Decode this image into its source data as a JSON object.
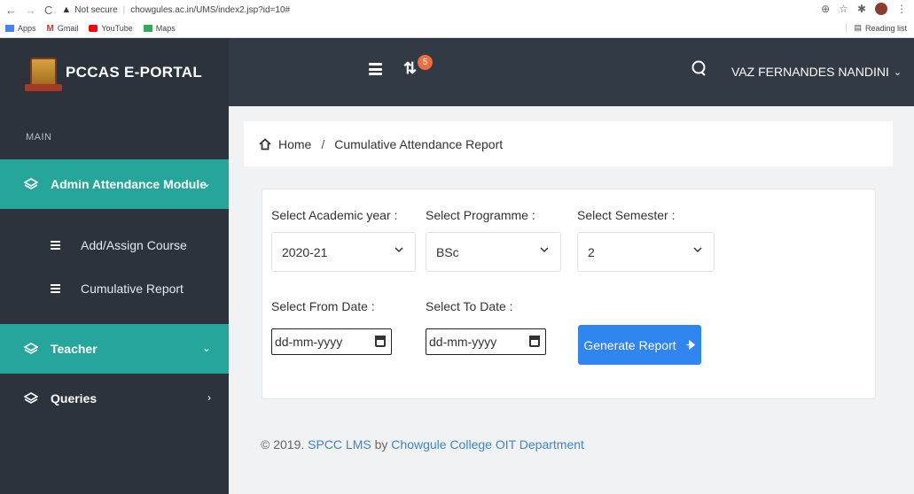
{
  "browser": {
    "not_secure": "Not secure",
    "url": "chowgules.ac.in/UMS/index2.jsp?id=10#",
    "bookmarks": [
      {
        "label": "Apps",
        "color": "#4285f4"
      },
      {
        "label": "Gmail",
        "color": "#d93025"
      },
      {
        "label": "YouTube",
        "color": "#ff0000"
      },
      {
        "label": "Maps",
        "color": "#34a853"
      }
    ],
    "reading_list": "Reading list"
  },
  "header": {
    "brand": "PCCAS E-PORTAL",
    "notification_count": "5",
    "user_name": "VAZ FERNANDES NANDINI"
  },
  "sidebar": {
    "section_label": "MAIN",
    "groups": [
      {
        "label": "Admin Attendance Module",
        "expanded": true
      },
      {
        "label": "Teacher",
        "expanded": true
      },
      {
        "label": "Queries",
        "expanded": false
      }
    ],
    "sub_items": [
      {
        "label": "Add/Assign Course"
      },
      {
        "label": "Cumulative Report"
      }
    ]
  },
  "breadcrumb": {
    "home": "Home",
    "current": "Cumulative Attendance Report"
  },
  "form": {
    "academic_year_label": "Select Academic year :",
    "academic_year_value": "2020-21",
    "programme_label": "Select Programme :",
    "programme_value": "BSc",
    "semester_label": "Select Semester :",
    "semester_value": "2",
    "from_date_label": "Select From Date :",
    "from_date_placeholder": "dd-mm-yyyy",
    "to_date_label": "Select To Date :",
    "to_date_placeholder": "dd-mm-yyyy",
    "generate_label": "Generate Report"
  },
  "footer": {
    "prefix": "© 2019. ",
    "lms": "SPCC LMS",
    "by": " by ",
    "dept": "Chowgule College OIT Department"
  },
  "colors": {
    "sidebar_bg": "#2c333d",
    "accent": "#26a69a",
    "button": "#2f86f1",
    "badge": "#f06d3f"
  }
}
